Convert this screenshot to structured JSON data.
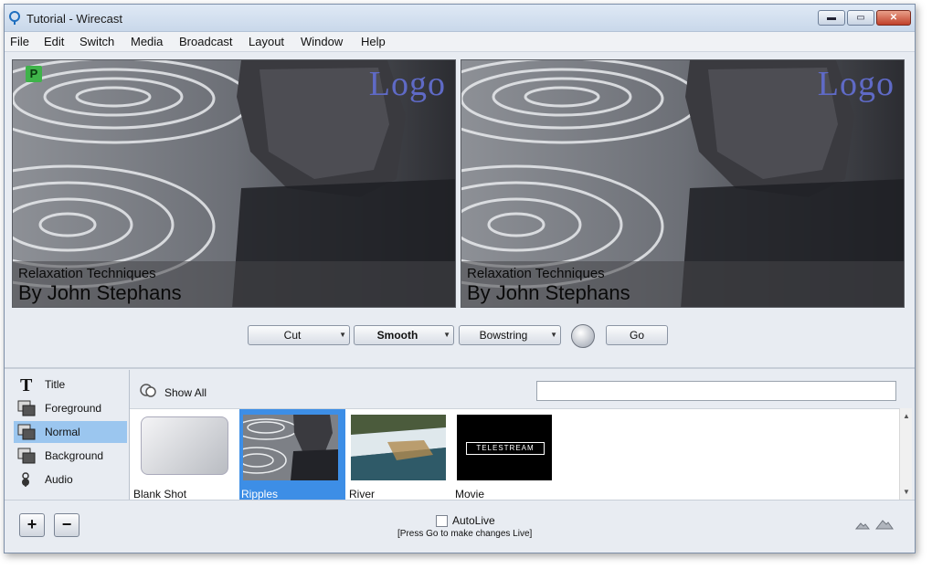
{
  "window": {
    "title": "Tutorial - Wirecast",
    "controls": {
      "minimize": "▬",
      "maximize": "▭",
      "close": "✕"
    }
  },
  "menu": [
    "File",
    "Edit",
    "Switch",
    "Media",
    "Broadcast",
    "Layout",
    "Window",
    "Help"
  ],
  "preview": {
    "badge": "P",
    "logo": "Logo",
    "line1": "Relaxation Techniques",
    "line2": "By John Stephans"
  },
  "live": {
    "logo": "Logo",
    "line1": "Relaxation Techniques",
    "line2": "By John Stephans"
  },
  "transitions": {
    "cut": "Cut",
    "smooth": "Smooth",
    "bowstring": "Bowstring",
    "go": "Go"
  },
  "layers": [
    {
      "label": "Title",
      "icon": "title-icon"
    },
    {
      "label": "Foreground",
      "icon": "layer-icon"
    },
    {
      "label": "Normal",
      "icon": "layer-icon",
      "selected": true
    },
    {
      "label": "Background",
      "icon": "layer-icon"
    },
    {
      "label": "Audio",
      "icon": "audio-icon"
    }
  ],
  "shots_bar": {
    "show_all": "Show All",
    "search_value": ""
  },
  "shots": [
    {
      "caption": "Blank Shot"
    },
    {
      "caption": "Ripples",
      "selected": true
    },
    {
      "caption": "River"
    },
    {
      "caption": "Movie",
      "thumb_text": "TELESTREAM"
    }
  ],
  "bottom": {
    "add": "+",
    "remove": "−",
    "autolive_label": "AutoLive",
    "autolive_checked": false,
    "autolive_hint": "[Press Go to make changes Live]"
  },
  "colors": {
    "selection": "#3d8ee6",
    "layer_selection": "#9bc6ef",
    "preview_badge": "#3fb34a",
    "logo_text": "#5f6ac6"
  }
}
